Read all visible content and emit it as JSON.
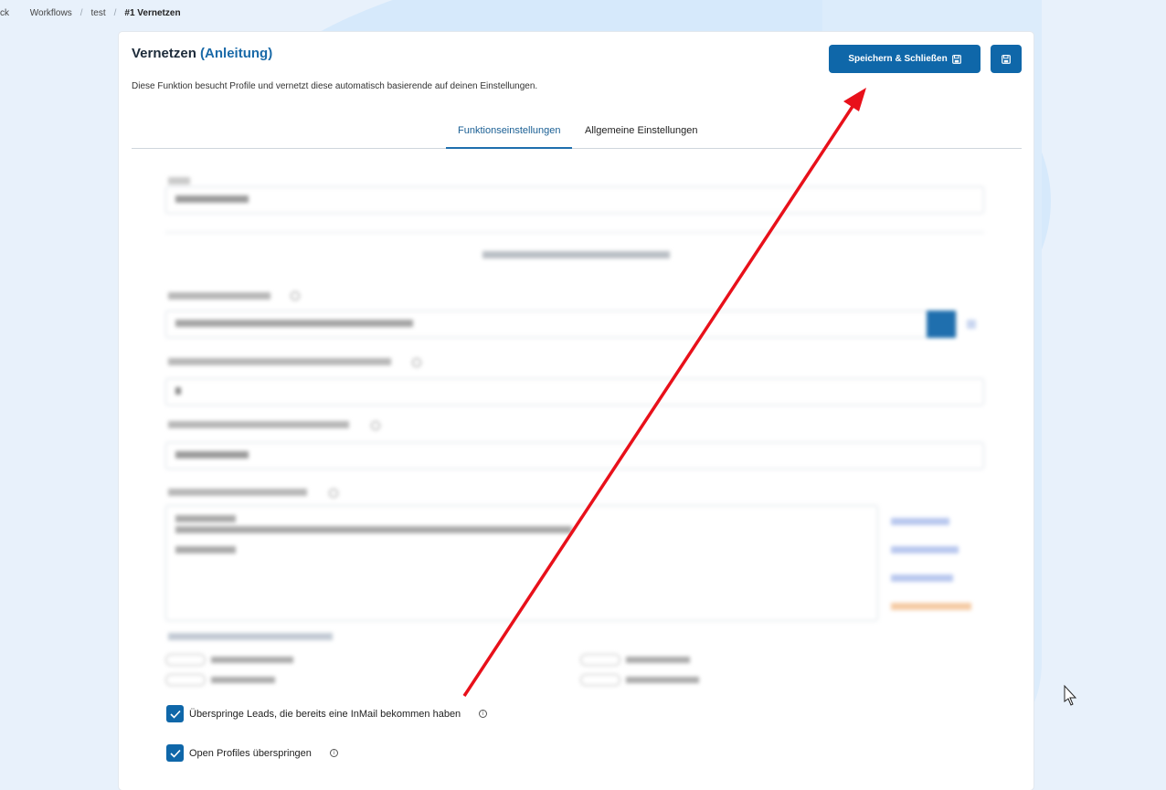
{
  "breadcrumb": {
    "items": [
      "ck",
      "Workflows",
      "test",
      "#1 Vernetzen"
    ],
    "separator": "/"
  },
  "header": {
    "title": "Vernetzen",
    "guide_link": "(Anleitung)",
    "description": "Diese Funktion besucht Profile und vernetzt diese automatisch basierende auf deinen Einstellungen.",
    "save_close_label": "Speichern & Schließen",
    "save_icon": "floppy-disk-icon"
  },
  "tabs": [
    {
      "label": "Funktionseinstellungen",
      "active": true
    },
    {
      "label": "Allgemeine Einstellungen",
      "active": false
    }
  ],
  "checkboxes": [
    {
      "label": "Überspringe Leads, die bereits eine InMail bekommen haben",
      "checked": true
    },
    {
      "label": "Open Profiles überspringen",
      "checked": true
    }
  ],
  "colors": {
    "primary": "#0f67a9",
    "annotation_arrow": "#e8101a"
  }
}
